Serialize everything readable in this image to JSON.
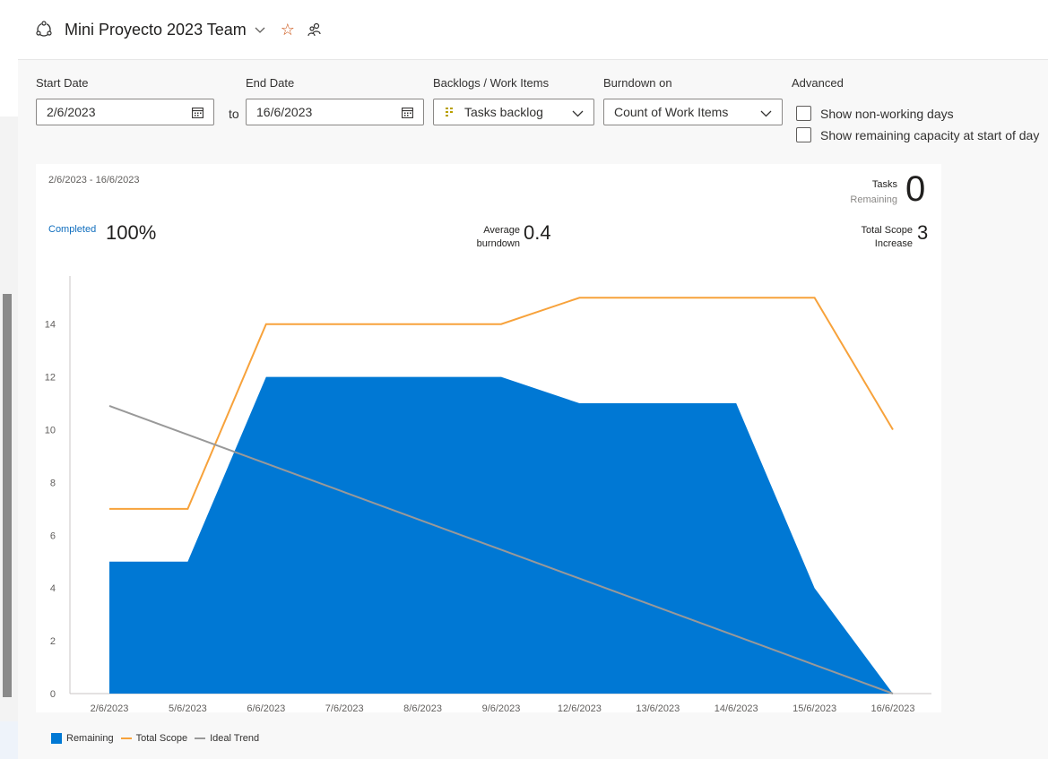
{
  "header": {
    "team_name": "Mini Proyecto 2023 Team"
  },
  "filters": {
    "start_label": "Start Date",
    "start_value": "2/6/2023",
    "to_label": "to",
    "end_label": "End Date",
    "end_value": "16/6/2023",
    "backlog_label": "Backlogs / Work Items",
    "backlog_value": "Tasks backlog",
    "burndown_label": "Burndown on",
    "burndown_value": "Count of Work Items",
    "advanced_label": "Advanced",
    "nonworking_label": "Show non-working days",
    "capacity_label": "Show remaining capacity at start of day"
  },
  "summary": {
    "date_range": "2/6/2023 - 16/6/2023",
    "completed_label": "Completed",
    "completed_value": "100%",
    "avg_label_1": "Average",
    "avg_label_2": "burndown",
    "avg_value": "0.4",
    "tasks_label": "Tasks",
    "remaining_label": "Remaining",
    "tasks_value": "0",
    "scope_label_1": "Total Scope",
    "scope_label_2": "Increase",
    "scope_value": "3"
  },
  "colors": {
    "remaining": "#0078d4",
    "total_scope": "#f7a23b",
    "ideal_trend": "#999999"
  },
  "chart_data": {
    "type": "area",
    "categories": [
      "2/6/2023",
      "5/6/2023",
      "6/6/2023",
      "7/6/2023",
      "8/6/2023",
      "9/6/2023",
      "12/6/2023",
      "13/6/2023",
      "14/6/2023",
      "15/6/2023",
      "16/6/2023"
    ],
    "ylim": [
      0,
      15
    ],
    "yticks": [
      0,
      2,
      4,
      6,
      8,
      10,
      12,
      14
    ],
    "series": [
      {
        "name": "Remaining",
        "kind": "area",
        "values": [
          5,
          5,
          12,
          12,
          12,
          12,
          11,
          11,
          11,
          4,
          0
        ]
      },
      {
        "name": "Total Scope",
        "kind": "line",
        "values": [
          7,
          7,
          14,
          14,
          14,
          14,
          15,
          15,
          15,
          15,
          10
        ]
      },
      {
        "name": "Ideal Trend",
        "kind": "line",
        "values": [
          10.9,
          9.81,
          8.72,
          7.63,
          6.54,
          5.45,
          4.36,
          3.27,
          2.18,
          1.09,
          0
        ]
      }
    ],
    "legend": [
      "Remaining",
      "Total Scope",
      "Ideal Trend"
    ],
    "legend_position": "bottom-left"
  }
}
